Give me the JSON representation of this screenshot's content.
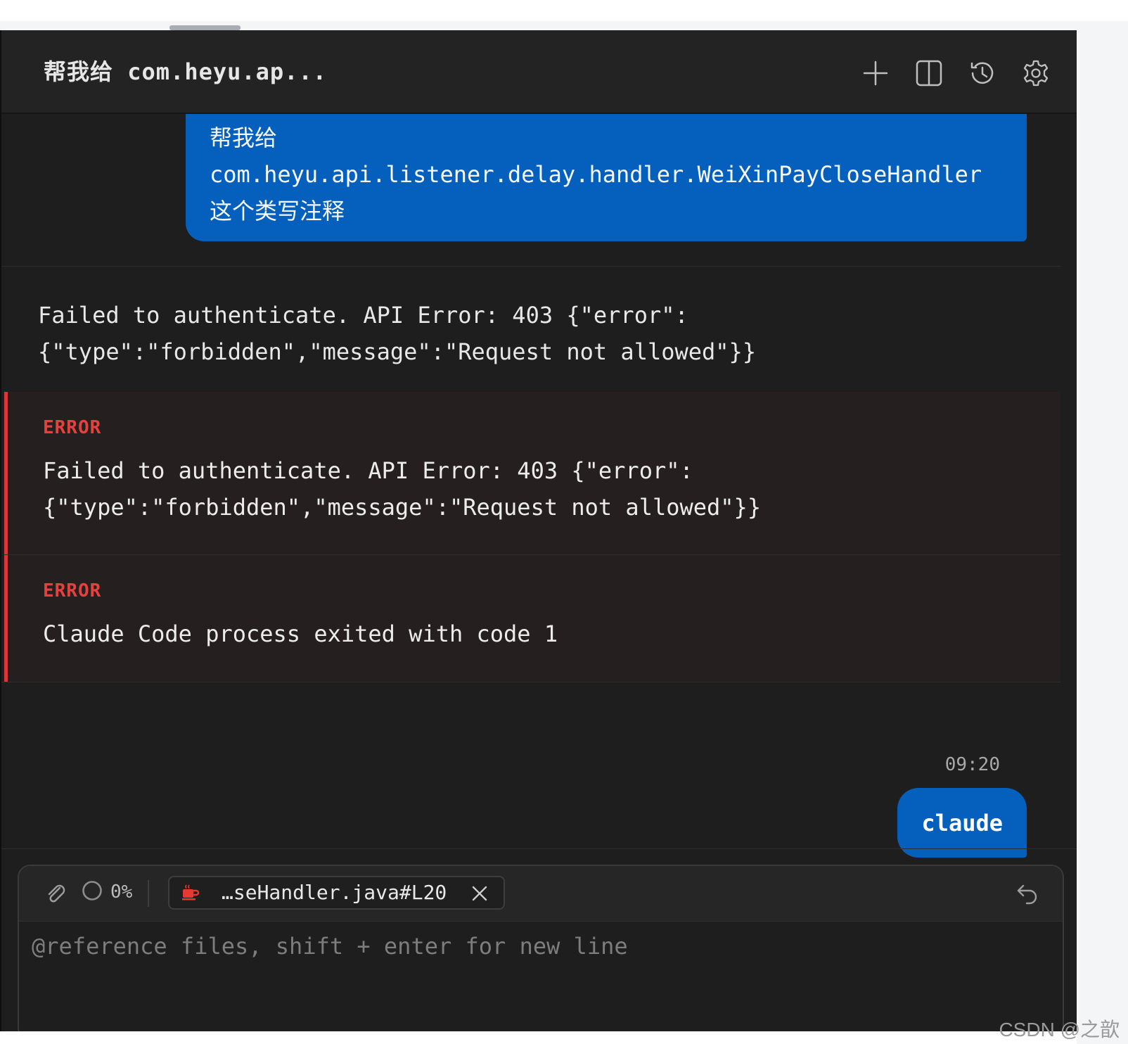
{
  "header": {
    "title": "帮我给 com.heyu.ap...",
    "actions": [
      {
        "name": "new-chat-icon",
        "icon": "plus"
      },
      {
        "name": "split-view-icon",
        "icon": "split-columns"
      },
      {
        "name": "history-icon",
        "icon": "clock-rewind"
      },
      {
        "name": "settings-icon",
        "icon": "gear"
      }
    ]
  },
  "messages": {
    "first_user": {
      "lines": [
        "帮我给",
        "com.heyu.api.listener.delay.handler.WeiXinPayCloseHandler",
        "这个类写注释"
      ]
    },
    "assistant": {
      "text": "Failed to authenticate. API Error: 403 {\"error\":\n{\"type\":\"forbidden\",\"message\":\"Request not allowed\"}}"
    },
    "errors": [
      {
        "label": "ERROR",
        "text": "Failed to authenticate. API Error: 403 {\"error\":\n{\"type\":\"forbidden\",\"message\":\"Request not allowed\"}}"
      },
      {
        "label": "ERROR",
        "text": "Claude Code process exited with code 1"
      }
    ],
    "second_user": {
      "timestamp": "09:20",
      "text": "claude"
    }
  },
  "composer": {
    "progress": "0%",
    "file_chip": {
      "label": "…seHandler.java#L20",
      "icon": "java-icon"
    },
    "placeholder": "@reference files, shift + enter for new line",
    "value": ""
  },
  "watermark": "CSDN @之歆",
  "colors": {
    "user_bubble": "#0460bc",
    "error_accent": "#d9373a",
    "error_label": "#e5423e",
    "background": "#1e1e1f"
  }
}
